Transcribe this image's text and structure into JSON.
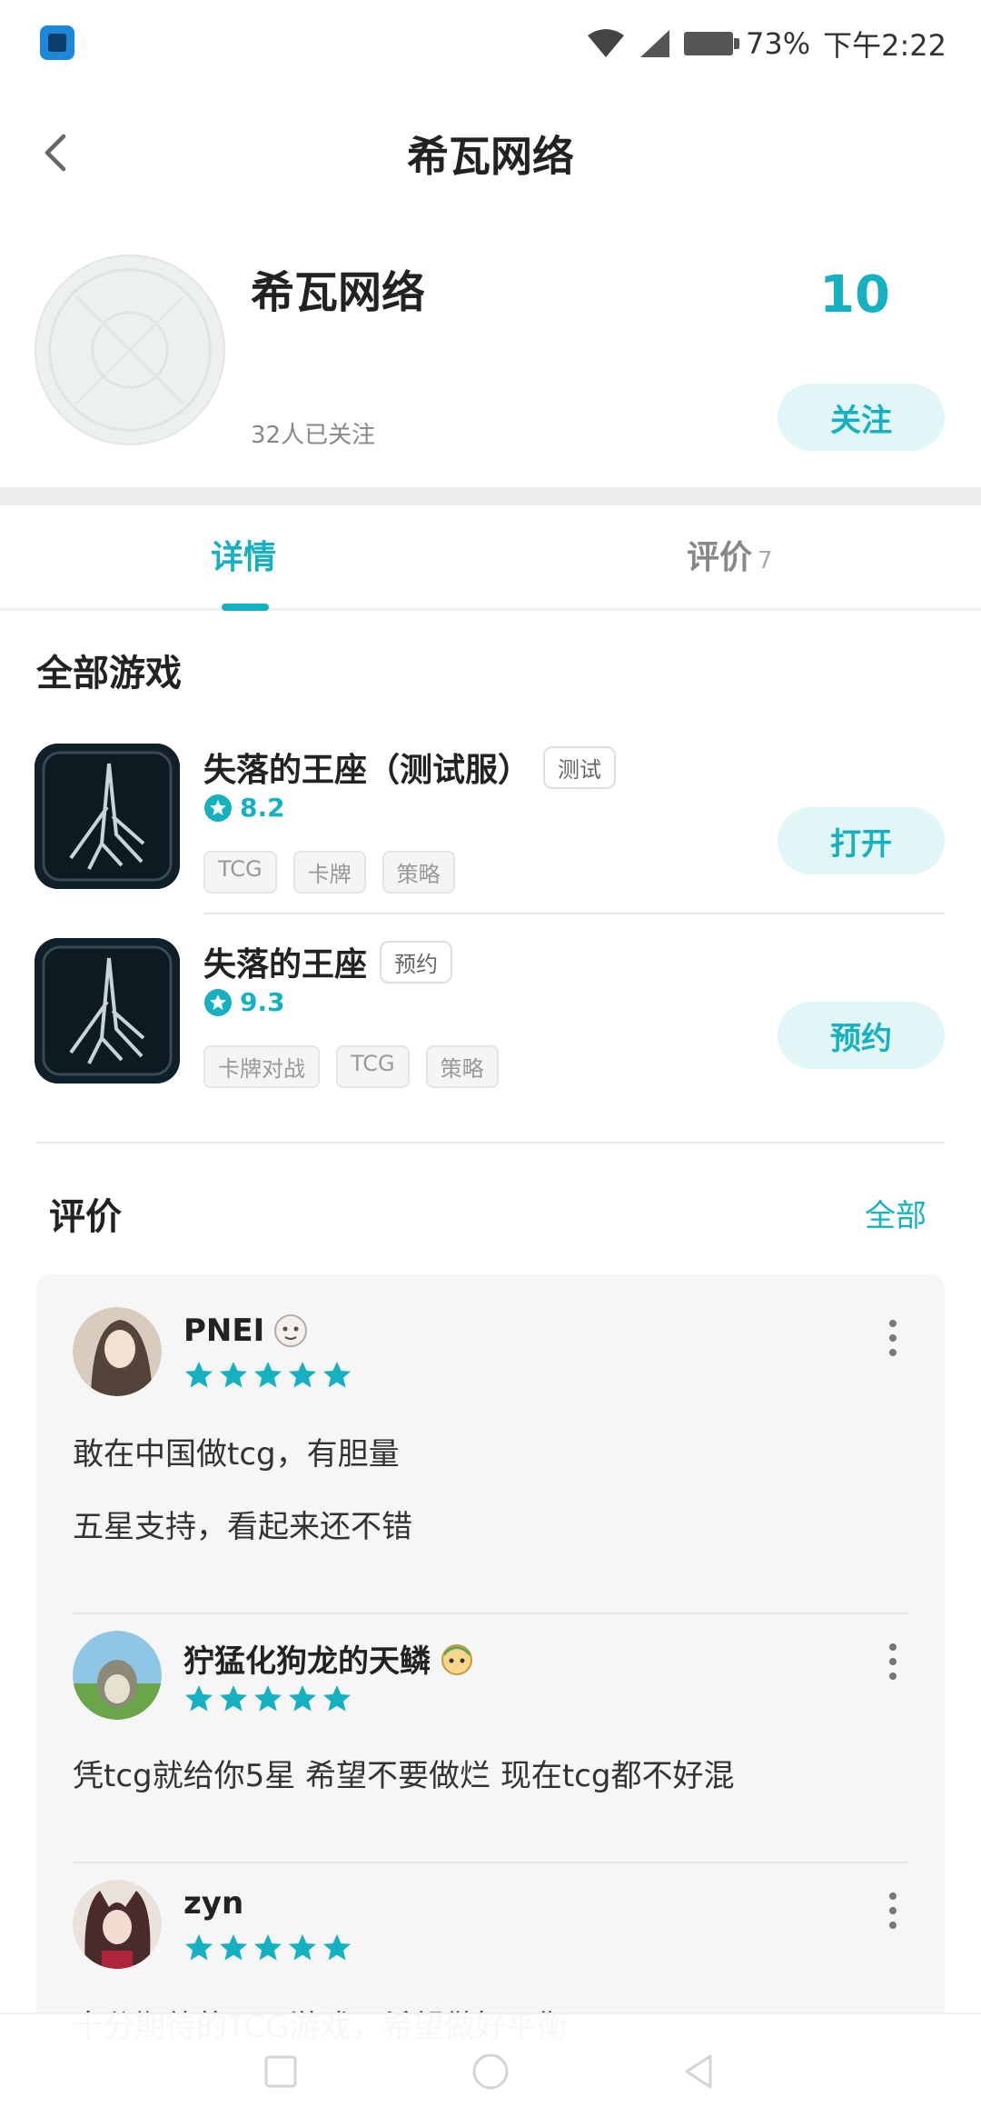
{
  "status_bar": {
    "battery": "73%",
    "time": "下午2:22"
  },
  "header": {
    "title": "希瓦网络"
  },
  "developer": {
    "name": "希瓦网络",
    "followers_text": "32人已关注",
    "count": "10",
    "follow_label": "关注"
  },
  "tabs": [
    {
      "label": "详情",
      "count": ""
    },
    {
      "label": "评价",
      "count": "7"
    }
  ],
  "games_section": {
    "title": "全部游戏",
    "games": [
      {
        "name": "失落的王座（测试服）",
        "badge": "测试",
        "rating": "8.2",
        "tags": [
          "TCG",
          "卡牌",
          "策略"
        ],
        "action_label": "打开"
      },
      {
        "name": "失落的王座",
        "badge": "预约",
        "rating": "9.3",
        "tags": [
          "卡牌对战",
          "TCG",
          "策略"
        ],
        "action_label": "预约"
      }
    ]
  },
  "reviews_section": {
    "title": "评价",
    "all_label": "全部",
    "accent_color": "#15b1c1",
    "reviews": [
      {
        "user": "PNEI",
        "stars": 5,
        "lines": [
          "敢在中国做tcg，有胆量",
          "五星支持，看起来还不错"
        ]
      },
      {
        "user": "狞猛化狗龙的天鳞",
        "stars": 5,
        "lines": [
          "凭tcg就给你5星 希望不要做烂 现在tcg都不好混"
        ]
      },
      {
        "user": "zyn",
        "stars": 5,
        "lines": [
          "十分期待的TCG游戏，希望做好平衡"
        ]
      }
    ]
  }
}
